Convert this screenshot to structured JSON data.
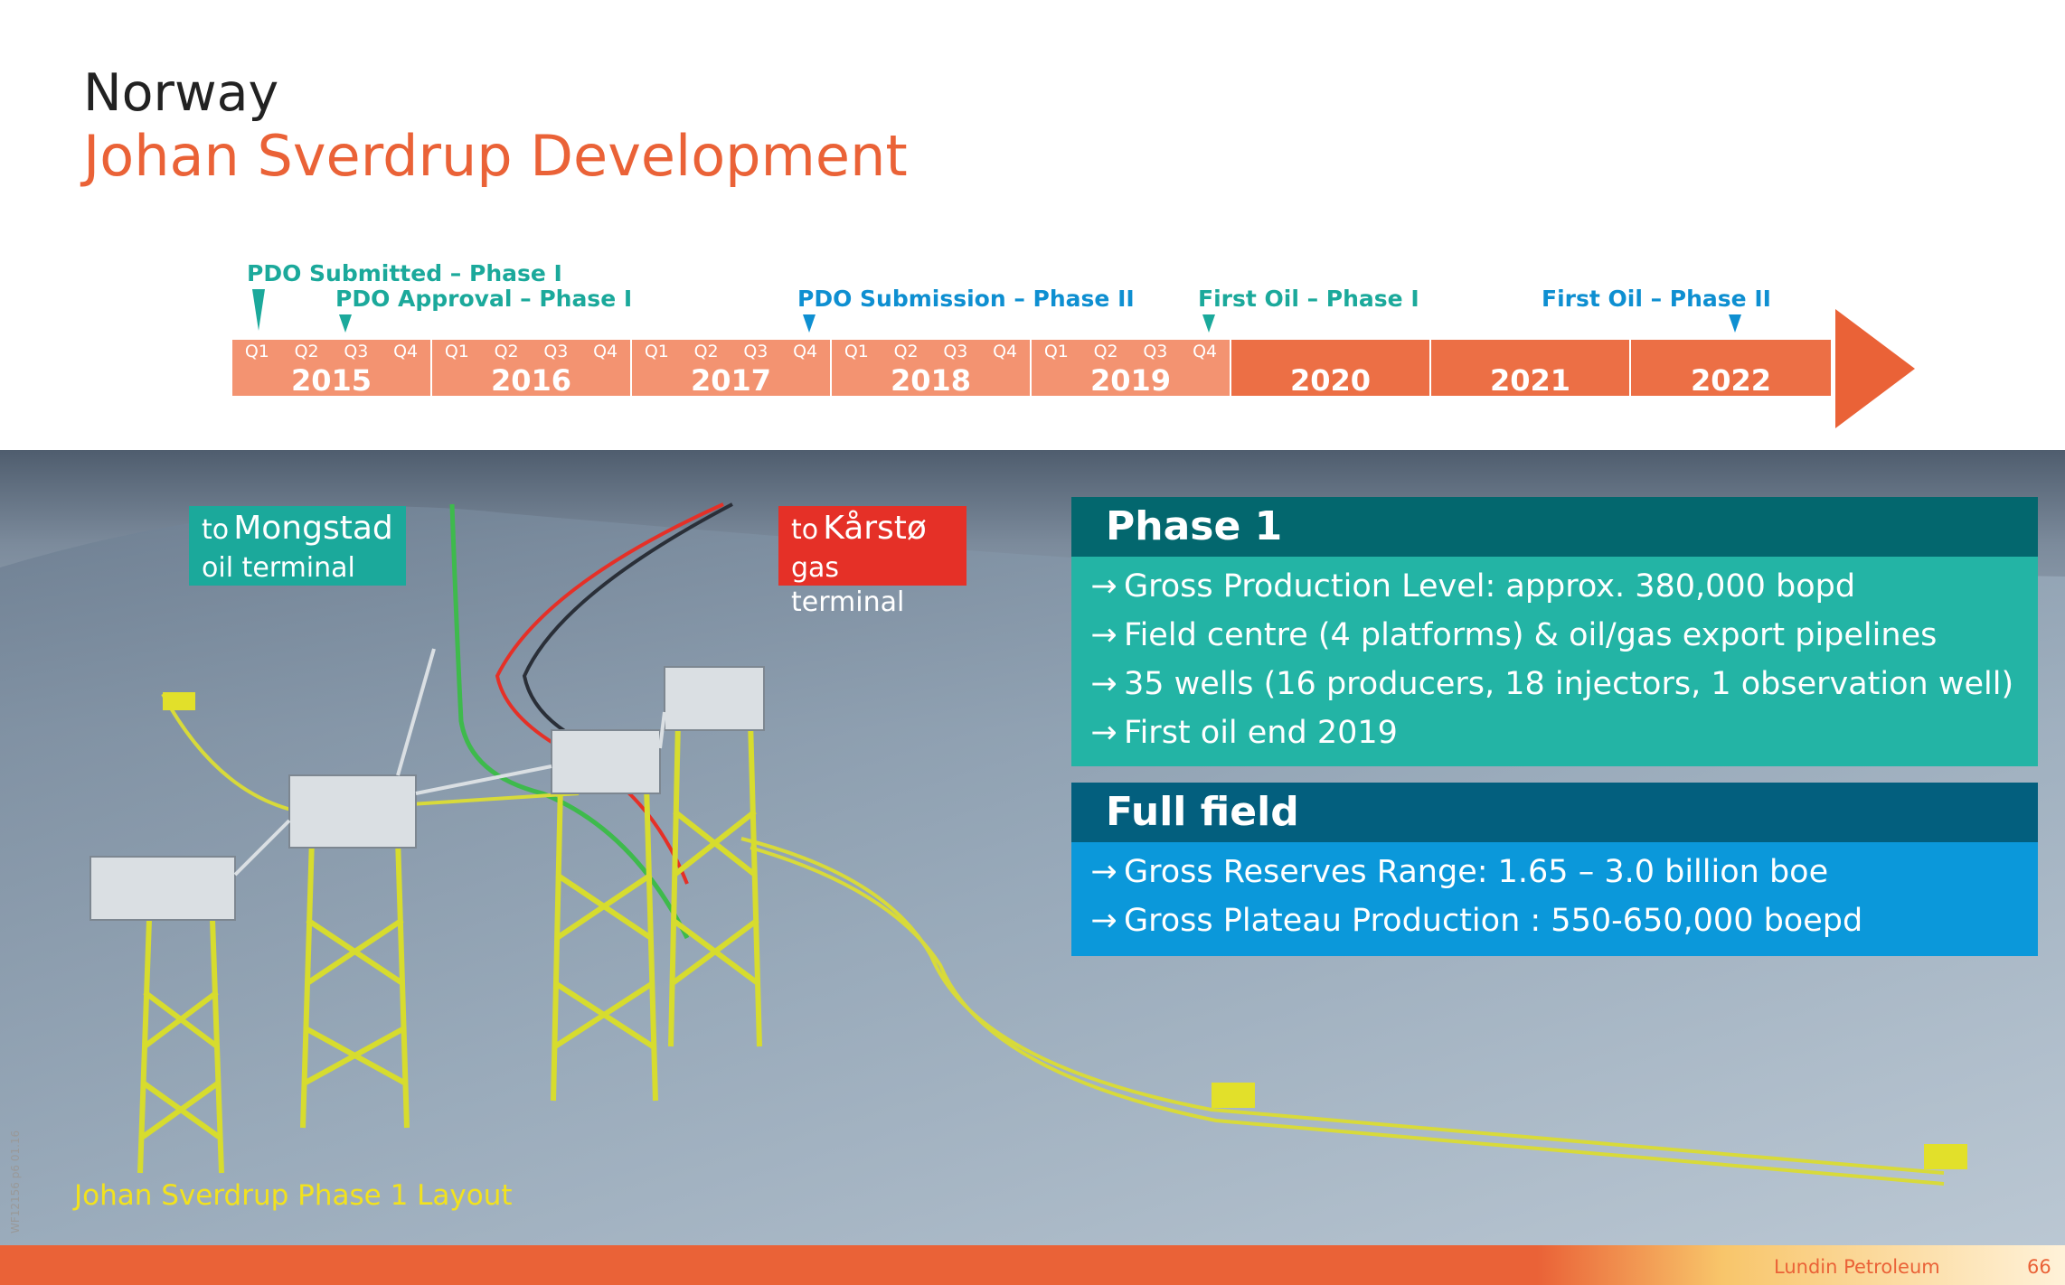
{
  "header": {
    "title": "Norway",
    "subtitle": "Johan Sverdrup Development"
  },
  "timeline": {
    "milestones": [
      {
        "label": "PDO Submitted – Phase I",
        "color": "#1BA99B"
      },
      {
        "label": "PDO Approval – Phase I",
        "color": "#1BA99B"
      },
      {
        "label": "PDO Submission – Phase II",
        "color": "#0E8FD1"
      },
      {
        "label": "First Oil – Phase I",
        "color": "#1BA99B"
      },
      {
        "label": "First Oil – Phase II",
        "color": "#0E8FD1"
      }
    ],
    "quarters": [
      "Q1",
      "Q2",
      "Q3",
      "Q4"
    ],
    "years": [
      "2015",
      "2016",
      "2017",
      "2018",
      "2019",
      "2020",
      "2021",
      "2022"
    ],
    "bar_colors": {
      "light": "#F39371",
      "dark": "#EC6F45",
      "arrow": "#EA6237"
    }
  },
  "callouts": {
    "mongstad": {
      "prefix": "to",
      "name": "Mongstad",
      "line2": "oil terminal",
      "color": "#1BA99B"
    },
    "karsto": {
      "prefix": "to",
      "name": "Kårstø",
      "line2": "gas terminal",
      "color": "#E53027"
    }
  },
  "phase1": {
    "title": "Phase 1",
    "head_color": "#03676E",
    "body_color": "#23B4A5",
    "bullets": [
      "Gross Production Level: approx. 380,000 bopd",
      "Field centre (4 platforms) & oil/gas export pipelines",
      "35 wells (16 producers, 18 injectors, 1 observation well)",
      "First oil end 2019"
    ]
  },
  "full_field": {
    "title": "Full field",
    "head_color": "#035F7E",
    "body_color": "#0B98DA",
    "bullets": [
      "Gross Reserves Range: 1.65 – 3.0 billion boe",
      "Gross Plateau Production : 550-650,000 boepd"
    ]
  },
  "bullet_arrow": "→",
  "image_caption": "Johan Sverdrup Phase 1 Layout",
  "doc_code": "WF12156 p6 01.16",
  "footer": {
    "company": "Lundin Petroleum",
    "page_number": "66",
    "color": "#EA6237"
  }
}
